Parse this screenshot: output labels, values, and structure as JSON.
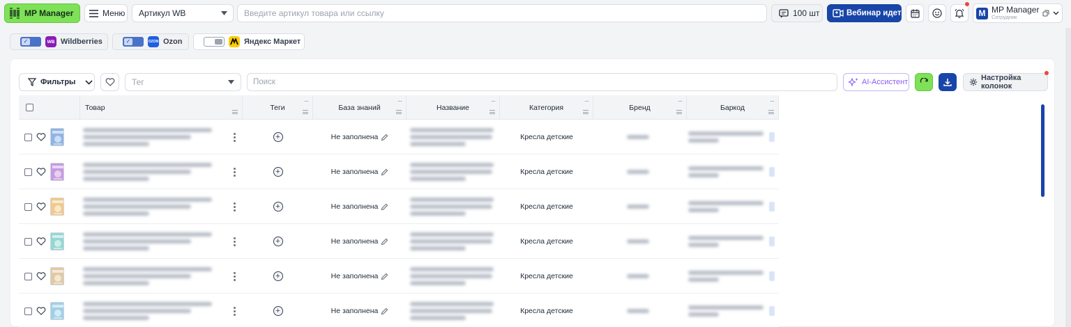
{
  "header": {
    "logo_text": "MP Manager",
    "menu_label": "Меню",
    "article_select_value": "Артикул WB",
    "search_placeholder": "Введите артикул товара или ссылку",
    "quantity_label": "100 шт",
    "webinar_label": "Вебинар идет",
    "user_name": "MP Manager",
    "user_role": "Сотрудник",
    "user_initial": "M"
  },
  "marketplaces": [
    {
      "name": "Wildberries",
      "enabled": true,
      "logo": "WB",
      "color": "#8a1cb8"
    },
    {
      "name": "Ozon",
      "enabled": true,
      "logo": "OZON",
      "color": "#1f5fe0"
    },
    {
      "name": "Яндекс Маркет",
      "enabled": false,
      "logo": "ym-logo",
      "color": "#ffcc00"
    }
  ],
  "toolbar": {
    "filters_label": "Фильтры",
    "tag_placeholder": "Тег",
    "search_placeholder": "Поиск",
    "ai_label": "AI-Ассистент",
    "columns_label": "Настройка колонок"
  },
  "table": {
    "columns": [
      "Товар",
      "Теги",
      "База знаний",
      "Название",
      "Категория",
      "Бренд",
      "Баркод"
    ],
    "rows": [
      {
        "knowledge_base": "Не заполнена",
        "category": "Кресла детские",
        "thumb_color": "#8fb4e6"
      },
      {
        "knowledge_base": "Не заполнена",
        "category": "Кресла детские",
        "thumb_color": "#c69be0"
      },
      {
        "knowledge_base": "Не заполнена",
        "category": "Кресла детские",
        "thumb_color": "#f1c98a"
      },
      {
        "knowledge_base": "Не заполнена",
        "category": "Кресла детские",
        "thumb_color": "#93d7d3"
      },
      {
        "knowledge_base": "Не заполнена",
        "category": "Кресла детские",
        "thumb_color": "#e0c9a3"
      },
      {
        "knowledge_base": "Не заполнена",
        "category": "Кресла детские",
        "thumb_color": "#9fd0e8"
      }
    ]
  },
  "colors": {
    "brand_green": "#7ee157",
    "brand_blue": "#1845a8",
    "alert_red": "#ef4444",
    "ai_purple": "#8b5cf6"
  }
}
